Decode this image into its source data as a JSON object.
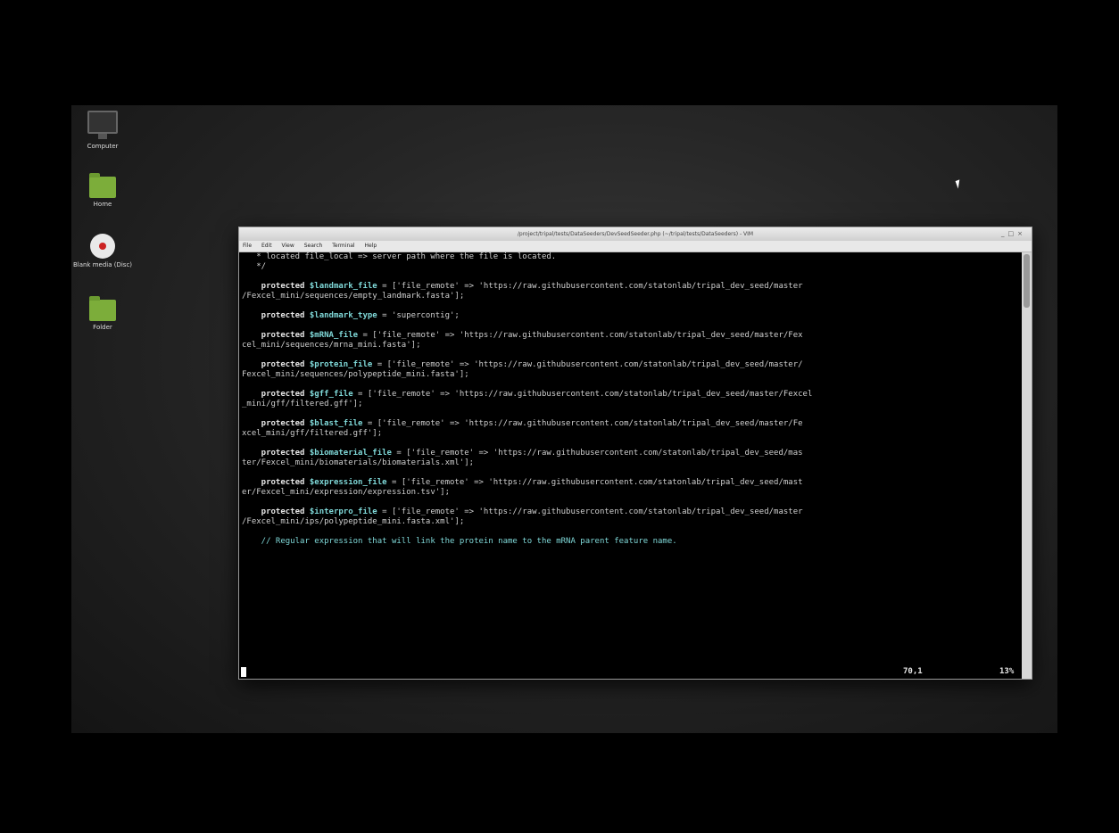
{
  "desktop": {
    "icons": [
      {
        "label": "Computer",
        "icon": "monitor-icon"
      },
      {
        "label": "Home",
        "icon": "folder-icon"
      },
      {
        "label": "Blank media (Disc)",
        "icon": "disc-icon"
      },
      {
        "label": "Folder",
        "icon": "folder-icon"
      }
    ]
  },
  "window": {
    "title": "/project/tripal/tests/DataSeeders/DevSeedSeeder.php (~/tripal/tests/DataSeeders) - VIM",
    "buttons": [
      "_",
      "□",
      "×"
    ],
    "menu": [
      "File",
      "Edit",
      "View",
      "Search",
      "Terminal",
      "Help"
    ]
  },
  "terminal": {
    "lines": [
      {
        "t": "comment_plain",
        "text": "   * located file_local => server path where the file is located."
      },
      {
        "t": "comment_plain",
        "text": "   */"
      },
      {
        "t": "blank",
        "text": ""
      },
      {
        "t": "decl",
        "kw": "    protected ",
        "var": "$landmark_file",
        "rest": " = ['file_remote' => 'https://raw.githubusercontent.com/statonlab/tripal_dev_seed/master"
      },
      {
        "t": "plain",
        "text": "/Fexcel_mini/sequences/empty_landmark.fasta'];"
      },
      {
        "t": "blank",
        "text": ""
      },
      {
        "t": "decl",
        "kw": "    protected ",
        "var": "$landmark_type",
        "rest": " = 'supercontig';"
      },
      {
        "t": "blank",
        "text": ""
      },
      {
        "t": "decl",
        "kw": "    protected ",
        "var": "$mRNA_file",
        "rest": " = ['file_remote' => 'https://raw.githubusercontent.com/statonlab/tripal_dev_seed/master/Fex"
      },
      {
        "t": "plain",
        "text": "cel_mini/sequences/mrna_mini.fasta'];"
      },
      {
        "t": "blank",
        "text": ""
      },
      {
        "t": "decl",
        "kw": "    protected ",
        "var": "$protein_file",
        "rest": " = ['file_remote' => 'https://raw.githubusercontent.com/statonlab/tripal_dev_seed/master/"
      },
      {
        "t": "plain",
        "text": "Fexcel_mini/sequences/polypeptide_mini.fasta'];"
      },
      {
        "t": "blank",
        "text": ""
      },
      {
        "t": "decl",
        "kw": "    protected ",
        "var": "$gff_file",
        "rest": " = ['file_remote' => 'https://raw.githubusercontent.com/statonlab/tripal_dev_seed/master/Fexcel"
      },
      {
        "t": "plain",
        "text": "_mini/gff/filtered.gff'];"
      },
      {
        "t": "blank",
        "text": ""
      },
      {
        "t": "decl",
        "kw": "    protected ",
        "var": "$blast_file",
        "rest": " = ['file_remote' => 'https://raw.githubusercontent.com/statonlab/tripal_dev_seed/master/Fe"
      },
      {
        "t": "plain",
        "text": "xcel_mini/gff/filtered.gff'];"
      },
      {
        "t": "blank",
        "text": ""
      },
      {
        "t": "decl",
        "kw": "    protected ",
        "var": "$biomaterial_file",
        "rest": " = ['file_remote' => 'https://raw.githubusercontent.com/statonlab/tripal_dev_seed/mas"
      },
      {
        "t": "plain",
        "text": "ter/Fexcel_mini/biomaterials/biomaterials.xml'];"
      },
      {
        "t": "blank",
        "text": ""
      },
      {
        "t": "decl",
        "kw": "    protected ",
        "var": "$expression_file",
        "rest": " = ['file_remote' => 'https://raw.githubusercontent.com/statonlab/tripal_dev_seed/mast"
      },
      {
        "t": "plain",
        "text": "er/Fexcel_mini/expression/expression.tsv'];"
      },
      {
        "t": "blank",
        "text": ""
      },
      {
        "t": "decl",
        "kw": "    protected ",
        "var": "$interpro_file",
        "rest": " = ['file_remote' => 'https://raw.githubusercontent.com/statonlab/tripal_dev_seed/master"
      },
      {
        "t": "plain",
        "text": "/Fexcel_mini/ips/polypeptide_mini.fasta.xml'];"
      },
      {
        "t": "blank",
        "text": ""
      },
      {
        "t": "comment",
        "text": "    // Regular expression that will link the protein name to the mRNA parent feature name."
      }
    ],
    "status": {
      "position": "70,1",
      "percent": "13%"
    }
  },
  "colors": {
    "keyword": "#e6e6e6",
    "variable": "#7fd8d8",
    "comment": "#7fd8d8",
    "text": "#cfcfcf"
  }
}
